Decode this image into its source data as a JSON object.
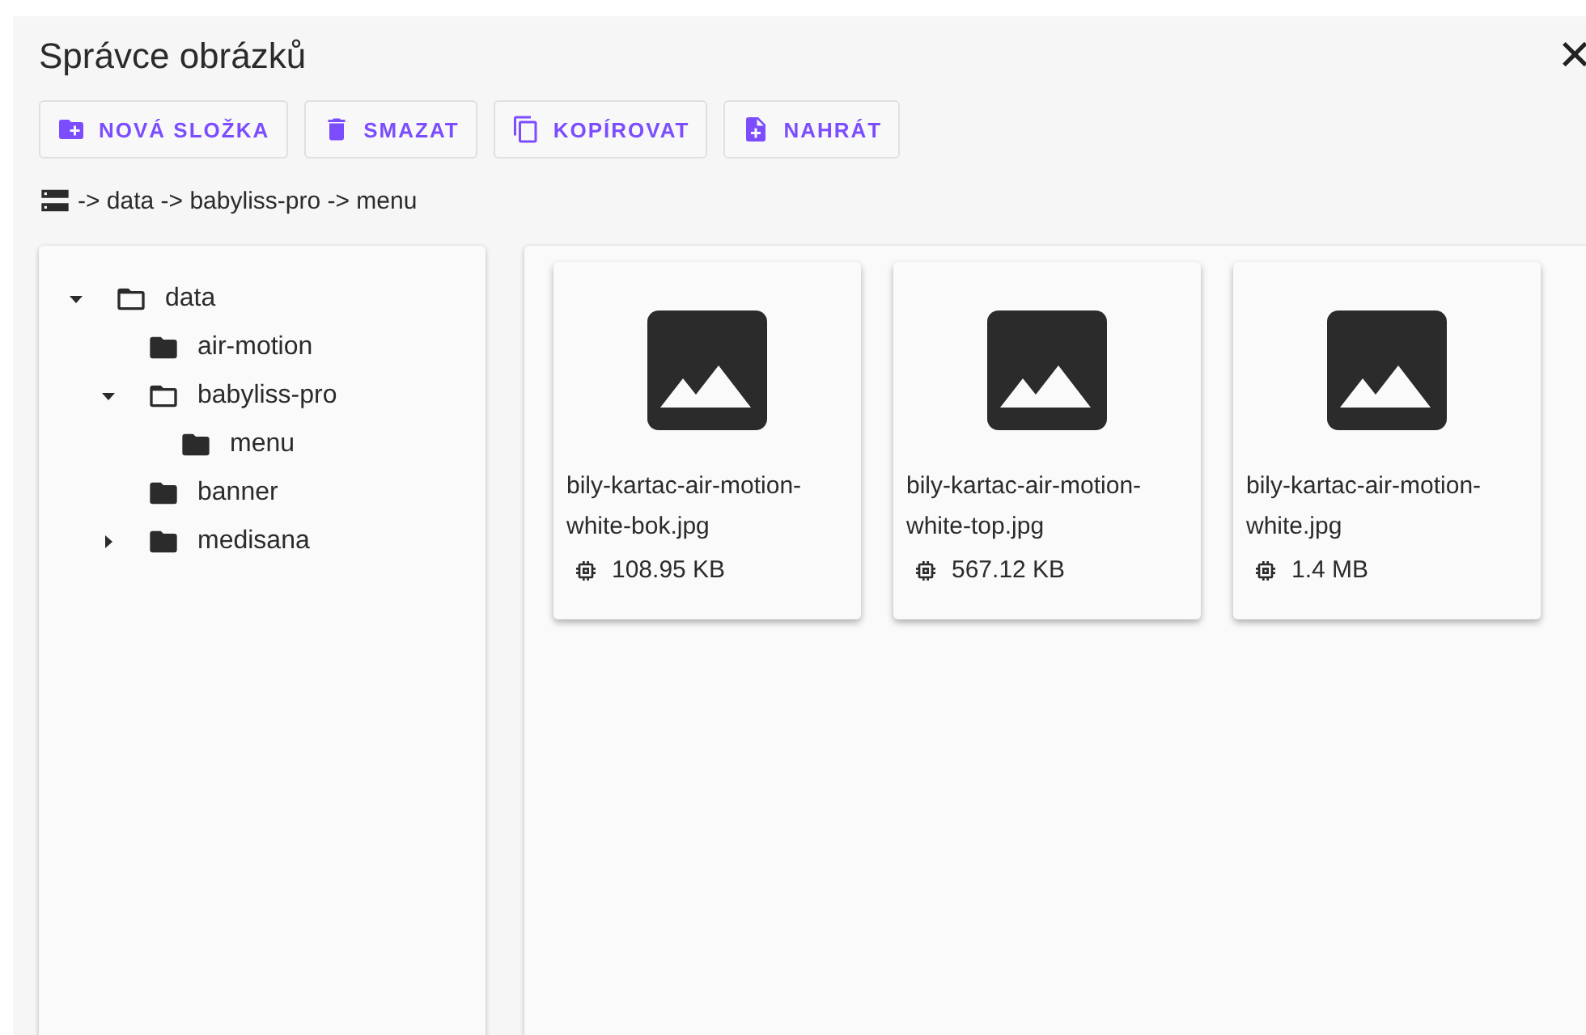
{
  "dialog": {
    "title": "Správce obrázků",
    "close": "✕"
  },
  "toolbar": [
    {
      "kind": "new-folder",
      "label": "NOVÁ SLOŽKA"
    },
    {
      "kind": "delete",
      "label": "SMAZAT"
    },
    {
      "kind": "copy",
      "label": "KOPÍROVAT"
    },
    {
      "kind": "upload",
      "label": "NAHRÁT"
    }
  ],
  "breadcrumb": "-> data -> babyliss-pro -> menu",
  "tree": [
    {
      "label": "data",
      "expandable": true,
      "expanded": true,
      "children": [
        {
          "label": "air-motion",
          "expandable": false,
          "expanded": false
        },
        {
          "label": "babyliss-pro",
          "expandable": true,
          "expanded": true,
          "children": [
            {
              "label": "menu",
              "expandable": false,
              "expanded": false
            }
          ]
        },
        {
          "label": "banner",
          "expandable": false,
          "expanded": false
        },
        {
          "label": "medisana",
          "expandable": true,
          "expanded": false
        }
      ]
    }
  ],
  "files": [
    {
      "name": "bily-kartac-air-motion-white-bok.jpg",
      "size": "108.95 KB"
    },
    {
      "name": "bily-kartac-air-motion-white-top.jpg",
      "size": "567.12 KB"
    },
    {
      "name": "bily-kartac-air-motion-white.jpg",
      "size": "1.4 MB"
    }
  ]
}
